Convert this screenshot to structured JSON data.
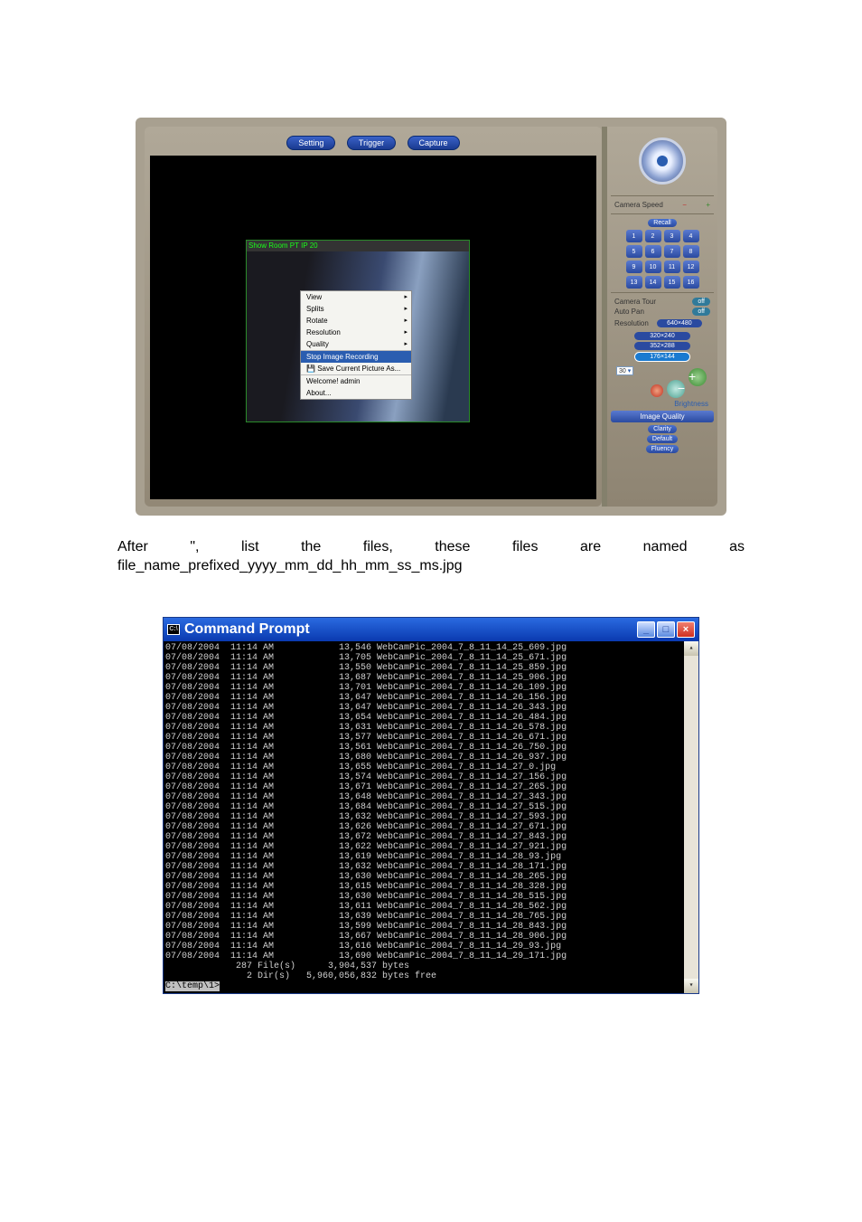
{
  "viewer": {
    "buttons": {
      "setting": "Setting",
      "trigger": "Trigger",
      "capture": "Capture"
    },
    "cam_title": "Show Room PT IP   20",
    "context_menu": [
      {
        "label": "View",
        "arrow": true
      },
      {
        "label": "Splits",
        "arrow": true
      },
      {
        "label": "Rotate",
        "arrow": true
      },
      {
        "label": "Resolution",
        "arrow": true
      },
      {
        "label": "Quality",
        "arrow": true
      },
      {
        "label": "Stop Image Recording",
        "selected": true,
        "sep": true
      },
      {
        "label": "Save Current Picture As...",
        "icon": true
      },
      {
        "label": "Welcome! admin",
        "sep": true
      },
      {
        "label": "About..."
      }
    ]
  },
  "side": {
    "camera_speed": "Camera Speed",
    "recall": "Recall",
    "presets": [
      "1",
      "2",
      "3",
      "4",
      "5",
      "6",
      "7",
      "8",
      "9",
      "10",
      "11",
      "12",
      "13",
      "14",
      "15",
      "16"
    ],
    "camera_tour_label": "Camera Tour",
    "camera_tour_val": "off",
    "auto_pan_label": "Auto Pan",
    "auto_pan_val": "off",
    "resolution_label": "Resolution",
    "resolutions": [
      "640×480",
      "320×240",
      "352×288",
      "176×144"
    ],
    "sel_val": "30",
    "brightness": "Brightness",
    "image_quality": "Image Quality",
    "quality_btns": [
      "Clarity",
      "Default",
      "Fluency"
    ]
  },
  "body_text": "After \", list the files, these files are named as file_name_prefixed_yyyy_mm_dd_hh_mm_ss_ms.jpg",
  "prompt": {
    "title": "Command Prompt",
    "lines": [
      "07/08/2004  11:14 AM            13,546 WebCamPic_2004_7_8_11_14_25_609.jpg",
      "07/08/2004  11:14 AM            13,705 WebCamPic_2004_7_8_11_14_25_671.jpg",
      "07/08/2004  11:14 AM            13,550 WebCamPic_2004_7_8_11_14_25_859.jpg",
      "07/08/2004  11:14 AM            13,687 WebCamPic_2004_7_8_11_14_25_906.jpg",
      "07/08/2004  11:14 AM            13,701 WebCamPic_2004_7_8_11_14_26_109.jpg",
      "07/08/2004  11:14 AM            13,647 WebCamPic_2004_7_8_11_14_26_156.jpg",
      "07/08/2004  11:14 AM            13,647 WebCamPic_2004_7_8_11_14_26_343.jpg",
      "07/08/2004  11:14 AM            13,654 WebCamPic_2004_7_8_11_14_26_484.jpg",
      "07/08/2004  11:14 AM            13,631 WebCamPic_2004_7_8_11_14_26_578.jpg",
      "07/08/2004  11:14 AM            13,577 WebCamPic_2004_7_8_11_14_26_671.jpg",
      "07/08/2004  11:14 AM            13,561 WebCamPic_2004_7_8_11_14_26_750.jpg",
      "07/08/2004  11:14 AM            13,680 WebCamPic_2004_7_8_11_14_26_937.jpg",
      "07/08/2004  11:14 AM            13,655 WebCamPic_2004_7_8_11_14_27_0.jpg",
      "07/08/2004  11:14 AM            13,574 WebCamPic_2004_7_8_11_14_27_156.jpg",
      "07/08/2004  11:14 AM            13,671 WebCamPic_2004_7_8_11_14_27_265.jpg",
      "07/08/2004  11:14 AM            13,648 WebCamPic_2004_7_8_11_14_27_343.jpg",
      "07/08/2004  11:14 AM            13,684 WebCamPic_2004_7_8_11_14_27_515.jpg",
      "07/08/2004  11:14 AM            13,632 WebCamPic_2004_7_8_11_14_27_593.jpg",
      "07/08/2004  11:14 AM            13,626 WebCamPic_2004_7_8_11_14_27_671.jpg",
      "07/08/2004  11:14 AM            13,672 WebCamPic_2004_7_8_11_14_27_843.jpg",
      "07/08/2004  11:14 AM            13,622 WebCamPic_2004_7_8_11_14_27_921.jpg",
      "07/08/2004  11:14 AM            13,619 WebCamPic_2004_7_8_11_14_28_93.jpg",
      "07/08/2004  11:14 AM            13,632 WebCamPic_2004_7_8_11_14_28_171.jpg",
      "07/08/2004  11:14 AM            13,630 WebCamPic_2004_7_8_11_14_28_265.jpg",
      "07/08/2004  11:14 AM            13,615 WebCamPic_2004_7_8_11_14_28_328.jpg",
      "07/08/2004  11:14 AM            13,630 WebCamPic_2004_7_8_11_14_28_515.jpg",
      "07/08/2004  11:14 AM            13,611 WebCamPic_2004_7_8_11_14_28_562.jpg",
      "07/08/2004  11:14 AM            13,639 WebCamPic_2004_7_8_11_14_28_765.jpg",
      "07/08/2004  11:14 AM            13,599 WebCamPic_2004_7_8_11_14_28_843.jpg",
      "07/08/2004  11:14 AM            13,667 WebCamPic_2004_7_8_11_14_28_906.jpg",
      "07/08/2004  11:14 AM            13,616 WebCamPic_2004_7_8_11_14_29_93.jpg",
      "07/08/2004  11:14 AM            13,690 WebCamPic_2004_7_8_11_14_29_171.jpg",
      "             287 File(s)      3,904,537 bytes",
      "               2 Dir(s)   5,960,056,832 bytes free",
      "",
      "C:\\temp\\1>"
    ]
  }
}
